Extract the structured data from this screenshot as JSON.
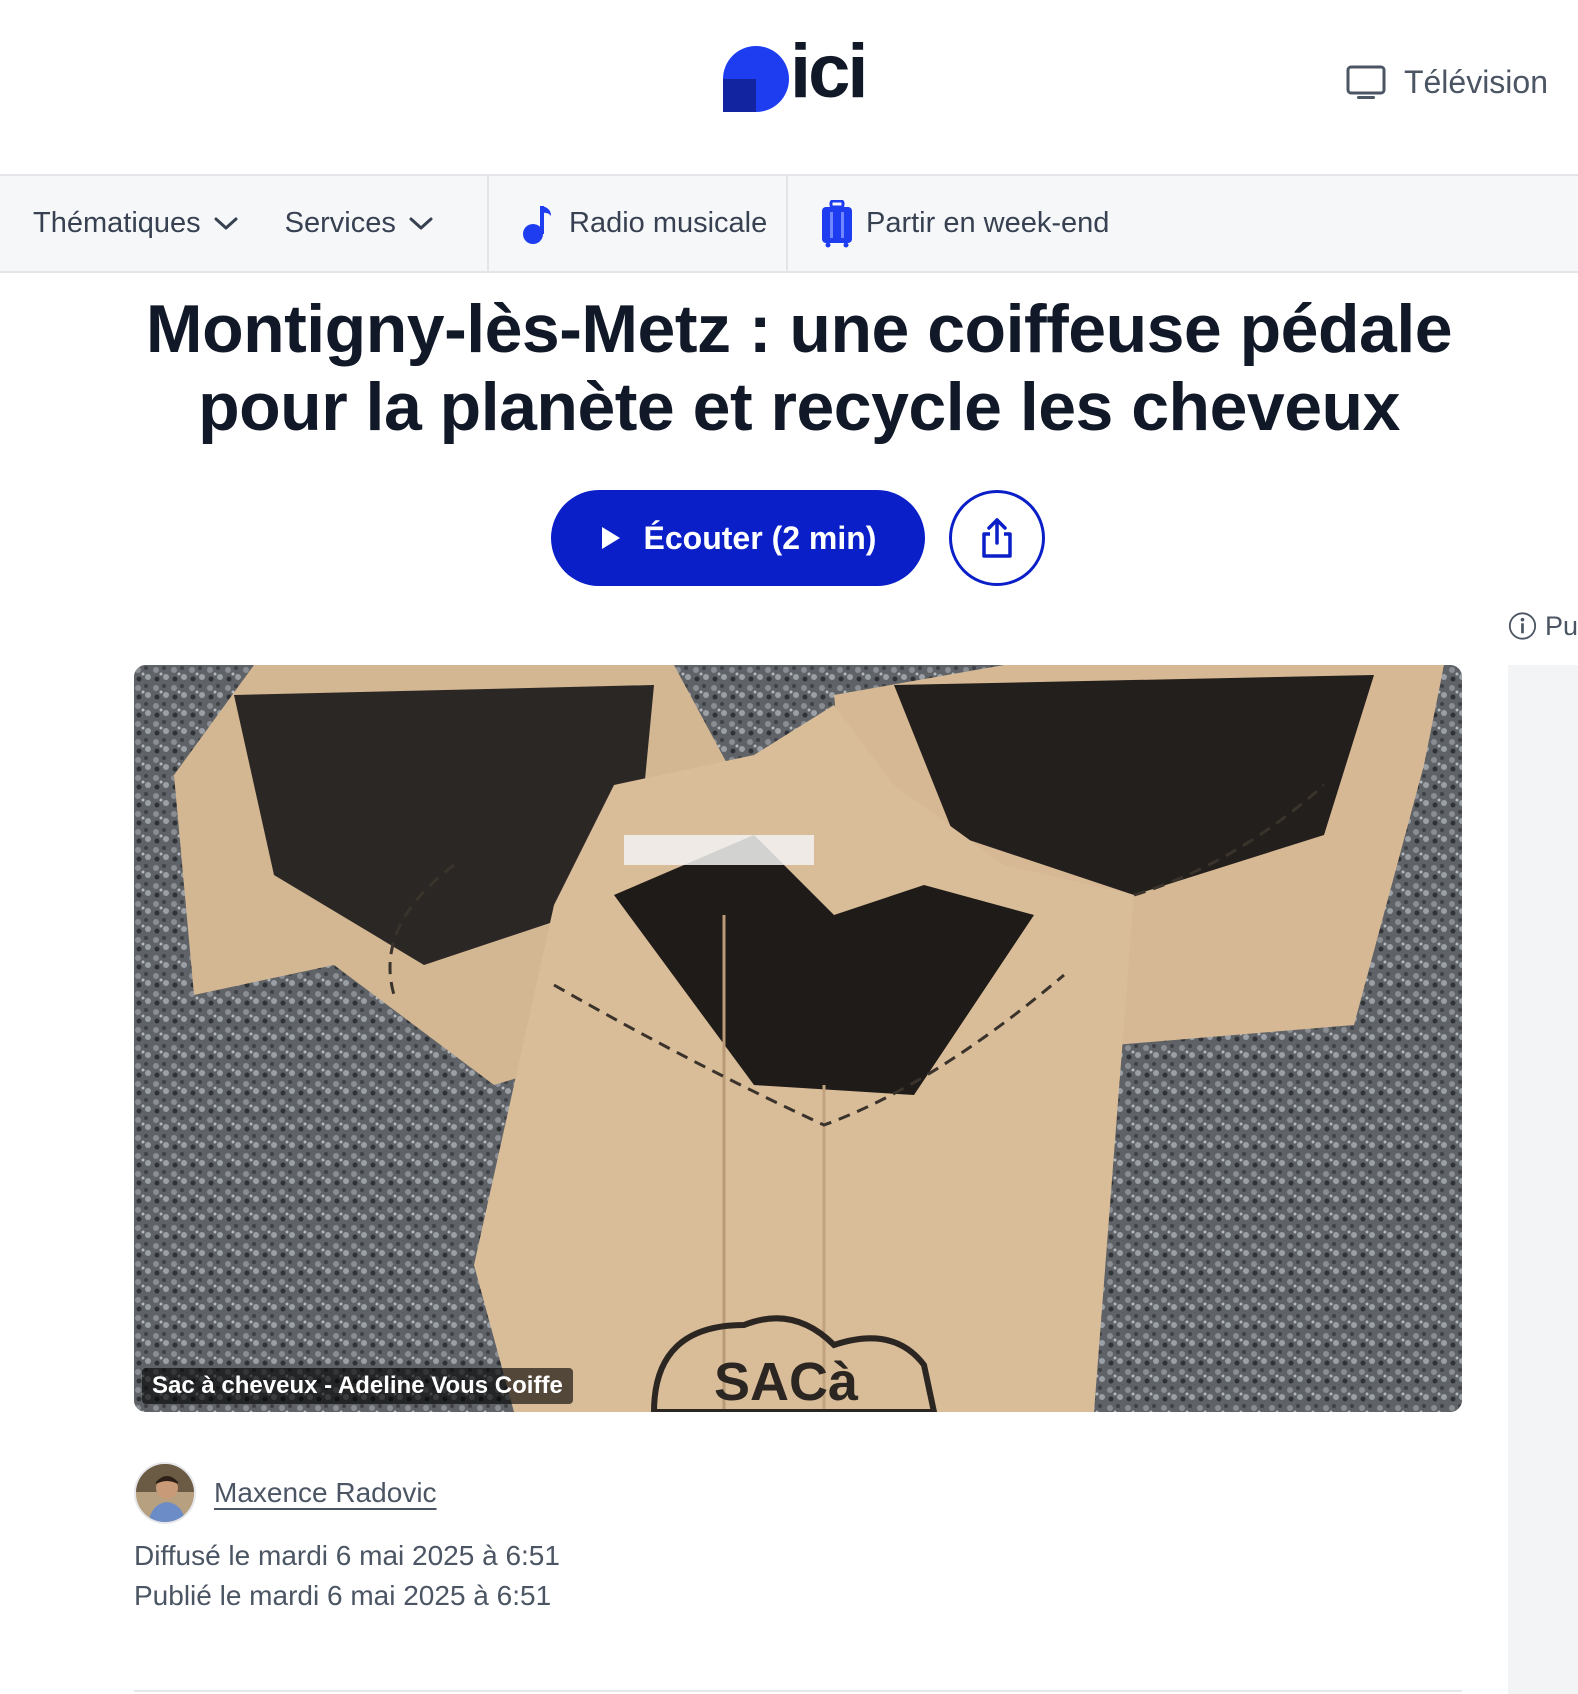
{
  "header": {
    "logo_text": "ici",
    "tv_label": "Télévision"
  },
  "nav": {
    "items": [
      {
        "label": "Thématiques",
        "icon": "chevron-down-icon"
      },
      {
        "label": "Services",
        "icon": "chevron-down-icon"
      },
      {
        "label": "Radio musicale",
        "icon": "music-note-icon"
      },
      {
        "label": "Partir en week-end",
        "icon": "suitcase-icon"
      }
    ]
  },
  "article": {
    "title": "Montigny-lès-Metz : une coiffeuse pédale pour la planète et recycle les cheveux",
    "listen_label": "Écouter (2 min)",
    "image_caption": "Sac à cheveux - Adeline Vous Coiffe",
    "author": "Maxence Radovic",
    "broadcast": "Diffusé le mardi 6 mai 2025 à 6:51",
    "published": "Publié le mardi 6 mai 2025 à 6:51"
  },
  "rail": {
    "label": "Pu"
  },
  "colors": {
    "brand_blue": "#0a1fc8",
    "logo_blue": "#1e3cf0",
    "text_dark": "#111827",
    "text_muted": "#4b5563"
  }
}
